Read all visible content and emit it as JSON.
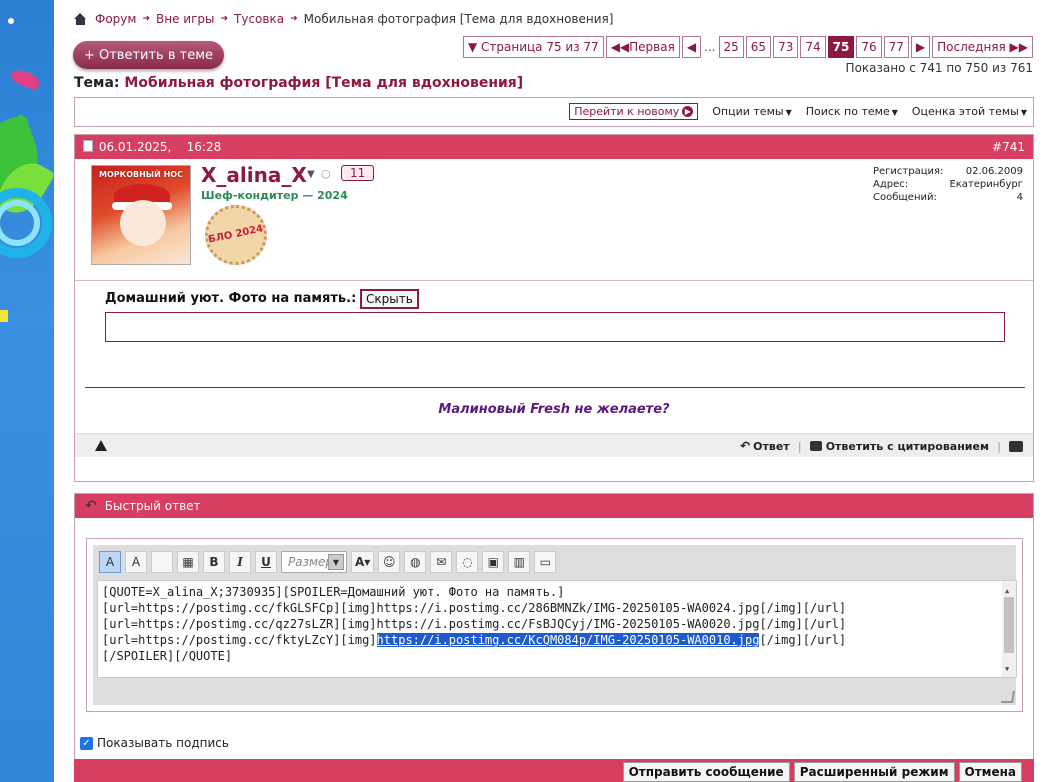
{
  "breadcrumb": {
    "items": [
      "Форум",
      "Вне игры",
      "Тусовка"
    ],
    "current": "Мобильная фотография [Тема для вдохновения]"
  },
  "reply_button": "+ Ответить в теме",
  "pagination": {
    "dropdown": "▼ Страница 75 из 77",
    "first": "◀◀Первая",
    "prev": "◀",
    "dots": "...",
    "pages": [
      "25",
      "65",
      "73",
      "74",
      "75",
      "76",
      "77"
    ],
    "current_page": "75",
    "next": "▶",
    "last": "Последняя ▶▶",
    "showing": "Показано с 741 по 750 из 761"
  },
  "topic": {
    "label": "Тема:",
    "title": "Мобильная фотография [Тема для вдохновения]"
  },
  "thread_tools": {
    "goto_new": "Перейти к новому",
    "options": "Опции темы",
    "search": "Поиск по теме",
    "rate": "Оценка этой темы"
  },
  "post": {
    "date": "06.01.2025,",
    "time": "16:28",
    "number": "#741",
    "user": {
      "name": "X_alina_X",
      "badge": "11",
      "title": "Шеф-кондитер — 2024",
      "avatar_caption": "МОРКОВНЫЙ НОС",
      "award_text": "БЛО 2024",
      "info": [
        {
          "label": "Регистрация:",
          "value": "02.06.2009"
        },
        {
          "label": "Адрес:",
          "value": "Екатеринбург"
        },
        {
          "label": "Сообщений:",
          "value": "4"
        }
      ]
    },
    "spoiler_label": "Домашний уют. Фото на память.:",
    "hide_button": "Скрыть",
    "signature": "Малиновый Fresh не желаете?",
    "actions": {
      "reply": "Ответ",
      "quote": "Ответить с цитированием"
    }
  },
  "quick_reply": {
    "title": "Быстрый ответ",
    "size_placeholder": "Размер",
    "text_lines": [
      "[QUOTE=X_alina_X;3730935][SPOILER=Домашний уют. Фото на память.]",
      "[url=https://postimg.cc/fkGLSFCp][img]https://i.postimg.cc/286BMNZk/IMG-20250105-WA0024.jpg[/img][/url]",
      "[url=https://postimg.cc/qz27sLZR][img]https://i.postimg.cc/FsBJQCyj/IMG-20250105-WA0020.jpg[/img][/url]"
    ],
    "line4_prefix": "[url=https://postimg.cc/fktyLZcY][img]",
    "line4_highlight": "https://i.postimg.cc/KcQM084p/IMG-20250105-WA0010.jpg",
    "line4_suffix": "[/img][/url]",
    "text_last": "[/SPOILER][/QUOTE]",
    "show_signature": "Показывать подпись",
    "buttons": {
      "send": "Отправить сообщение",
      "advanced": "Расширенный режим",
      "cancel": "Отмена"
    }
  },
  "colors": {
    "accent": "#8c1a3e",
    "header": "#d63e62"
  }
}
